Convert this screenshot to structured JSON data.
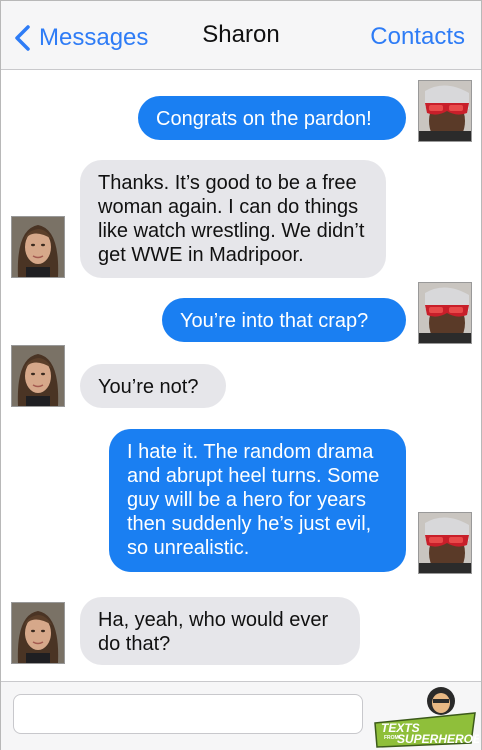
{
  "header": {
    "back_label": "Messages",
    "title": "Sharon",
    "contacts_label": "Contacts"
  },
  "messages": [
    {
      "from": "me",
      "text": "Congrats on the pardon!"
    },
    {
      "from": "Sharon",
      "text": "Thanks. It’s good to be a free woman again. I can do things like watch wrestling. We didn’t get WWE in Madripoor."
    },
    {
      "from": "me",
      "text": "You’re into that crap?"
    },
    {
      "from": "Sharon",
      "text": "You’re not?"
    },
    {
      "from": "me",
      "text": "I hate it. The random drama and abrupt heel turns. Some guy will be a hero for years then suddenly he’s just evil, so unrealistic."
    },
    {
      "from": "Sharon",
      "text": "Ha, yeah, who would ever do that?"
    }
  ],
  "footer": {
    "input_value": "",
    "input_placeholder": ""
  },
  "logo": {
    "line1": "TEXTS",
    "line2": "FROM",
    "line3": "SUPERHEROES"
  },
  "colors": {
    "accent": "#2e7cf6",
    "outgoing_bubble": "#1a7ff2",
    "incoming_bubble": "#e6e6ea",
    "logo_green": "#8fbf3a"
  },
  "icons": {
    "back": "chevron-left-icon",
    "avatar_me": "goggles-avatar",
    "avatar_sharon": "woman-avatar"
  }
}
